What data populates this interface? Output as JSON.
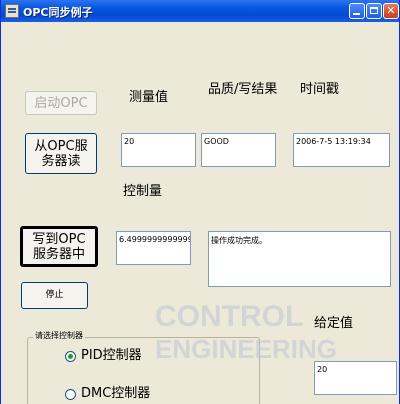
{
  "window": {
    "title": "OPC同步例子"
  },
  "buttons": {
    "start_opc": "启动OPC",
    "read_from_server": "从OPC服务器读",
    "write_to_server": "写到OPC服务器中",
    "stop": "停止"
  },
  "labels": {
    "measured_value": "测量值",
    "quality_write_result": "品质/写结果",
    "timestamp": "时间戳",
    "control_value": "控制量",
    "set_value": "给定值"
  },
  "fields": {
    "measured_value": "20",
    "quality": "GOOD",
    "timestamp": "2006-7-5 13:19:34",
    "control_value": "6.4999999999999",
    "write_result": "操作成功完成。",
    "set_value": "20"
  },
  "controller_group": {
    "title": "请选择控制器",
    "options": [
      "PID控制器",
      "DMC控制器"
    ],
    "selected": "PID控制器"
  },
  "watermark": {
    "line1": "CONTROL",
    "line2": "ENGINEERING"
  }
}
